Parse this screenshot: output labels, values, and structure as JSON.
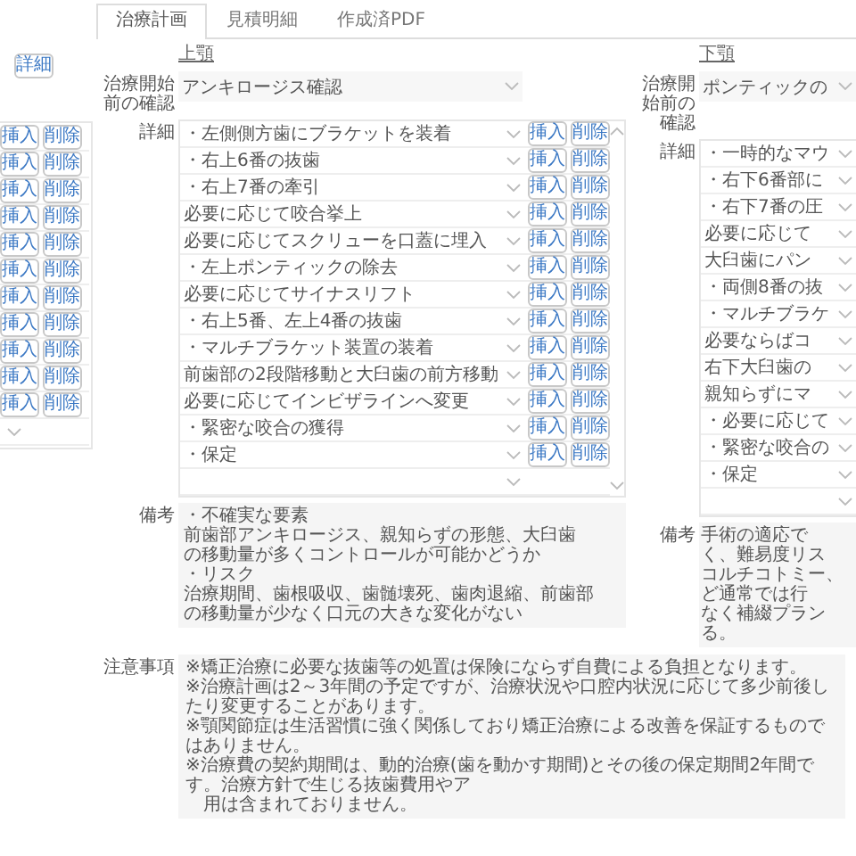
{
  "side_panel": {
    "detail_button": "詳細",
    "rows": [
      {
        "kind": "buttons",
        "insert": "挿入",
        "delete": "削除"
      },
      {
        "kind": "buttons",
        "insert": "挿入",
        "delete": "削除"
      },
      {
        "kind": "buttons",
        "insert": "挿入",
        "delete": "削除"
      },
      {
        "kind": "buttons",
        "insert": "挿入",
        "delete": "削除"
      },
      {
        "kind": "buttons",
        "insert": "挿入",
        "delete": "削除"
      },
      {
        "kind": "buttons",
        "insert": "挿入",
        "delete": "削除"
      },
      {
        "kind": "buttons",
        "insert": "挿入",
        "delete": "削除"
      },
      {
        "kind": "buttons",
        "insert": "挿入",
        "delete": "削除"
      },
      {
        "kind": "buttons",
        "insert": "挿入",
        "delete": "削除"
      },
      {
        "kind": "buttons",
        "insert": "挿入",
        "delete": "削除"
      },
      {
        "kind": "buttons",
        "insert": "挿入",
        "delete": "削除"
      },
      {
        "kind": "blank"
      }
    ]
  },
  "tabs": [
    {
      "label": "治療計画",
      "selected": true
    },
    {
      "label": "見積明細",
      "selected": false
    },
    {
      "label": "作成済PDF",
      "selected": false
    }
  ],
  "sections": [
    {
      "heading": "上顎",
      "start_check": {
        "label": "治療開始前の確認",
        "value": "アンキロージス確認"
      },
      "details": {
        "label": "詳細",
        "rows": [
          {
            "kind": "item",
            "text": "・左側側方歯にブラケットを装着",
            "insert": "挿入",
            "delete": "削除"
          },
          {
            "kind": "item",
            "text": "・右上6番の抜歯",
            "insert": "挿入",
            "delete": "削除"
          },
          {
            "kind": "item",
            "text": "・右上7番の牽引",
            "insert": "挿入",
            "delete": "削除"
          },
          {
            "kind": "item",
            "text": "必要に応じて咬合挙上",
            "insert": "挿入",
            "delete": "削除"
          },
          {
            "kind": "item",
            "text": "必要に応じてスクリューを口蓋に埋入",
            "insert": "挿入",
            "delete": "削除"
          },
          {
            "kind": "item",
            "text": "・左上ポンティックの除去",
            "insert": "挿入",
            "delete": "削除"
          },
          {
            "kind": "item",
            "text": "必要に応じてサイナスリフト",
            "insert": "挿入",
            "delete": "削除"
          },
          {
            "kind": "item",
            "text": "・右上5番、左上4番の抜歯",
            "insert": "挿入",
            "delete": "削除"
          },
          {
            "kind": "item",
            "text": "・マルチブラケット装置の装着",
            "insert": "挿入",
            "delete": "削除"
          },
          {
            "kind": "item",
            "text": "前歯部の2段階移動と大臼歯の前方移動",
            "insert": "挿入",
            "delete": "削除"
          },
          {
            "kind": "item",
            "text": "必要に応じてインビザラインへ変更",
            "insert": "挿入",
            "delete": "削除"
          },
          {
            "kind": "item",
            "text": "・緊密な咬合の獲得",
            "insert": "挿入",
            "delete": "削除"
          },
          {
            "kind": "item",
            "text": "・保定",
            "insert": "挿入",
            "delete": "削除"
          },
          {
            "kind": "blank"
          }
        ]
      },
      "remarks": {
        "label": "備考",
        "lines": [
          "・不確実な要素",
          "前歯部アンキロージス、親知らずの形態、大臼歯",
          "の移動量が多くコントロールが可能かどうか",
          "・リスク",
          "治療期間、歯根吸収、歯髄壊死、歯肉退縮、前歯部",
          "の移動量が少なく口元の大きな変化がない"
        ]
      }
    },
    {
      "heading": "下顎",
      "start_check": {
        "label": "治療開始前の確認",
        "value": "ポンティックの"
      },
      "details": {
        "label": "詳細",
        "rows": [
          {
            "kind": "item",
            "text": "・一時的なマウ"
          },
          {
            "kind": "item",
            "text": "・右下6番部に"
          },
          {
            "kind": "item",
            "text": "・右下7番の圧"
          },
          {
            "kind": "item",
            "text": "必要に応じて"
          },
          {
            "kind": "item",
            "text": "大臼歯にパン"
          },
          {
            "kind": "item",
            "text": "・両側8番の抜"
          },
          {
            "kind": "item",
            "text": "・マルチブラケ"
          },
          {
            "kind": "item",
            "text": "必要ならばコ"
          },
          {
            "kind": "item",
            "text": "右下大臼歯の"
          },
          {
            "kind": "item",
            "text": "親知らずにマ"
          },
          {
            "kind": "item",
            "text": "・必要に応じて"
          },
          {
            "kind": "item",
            "text": "・緊密な咬合の"
          },
          {
            "kind": "item",
            "text": "・保定"
          },
          {
            "kind": "blank"
          }
        ]
      },
      "remarks": {
        "label": "備考",
        "lines": [
          "手術の適応で",
          "く、難易度リス",
          "コルチコトミー、",
          "ど通常では行",
          "なく補綴プラン",
          "る。"
        ]
      }
    }
  ],
  "notes": {
    "label": "注意事項",
    "items": [
      {
        "kind": "note",
        "text": "※矯正治療に必要な抜歯等の処置は保険にならず自費による負担となります。"
      },
      {
        "kind": "note",
        "text": "※治療計画は2～3年間の予定ですが、治療状況や口腔内状況に応じて多少前後したり変更することがあります。"
      },
      {
        "kind": "note",
        "text": "※顎関節症は生活習慣に強く関係しており矯正治療による改善を保証するものではありません。"
      },
      {
        "kind": "note",
        "text": "※治療費の契約期間は、動的治療(歯を動かす期間)とその後の保定期間2年間です。治療方針で生じる抜歯費用やア"
      },
      {
        "kind": "continuation",
        "text": "用は含まれておりません。"
      }
    ]
  }
}
